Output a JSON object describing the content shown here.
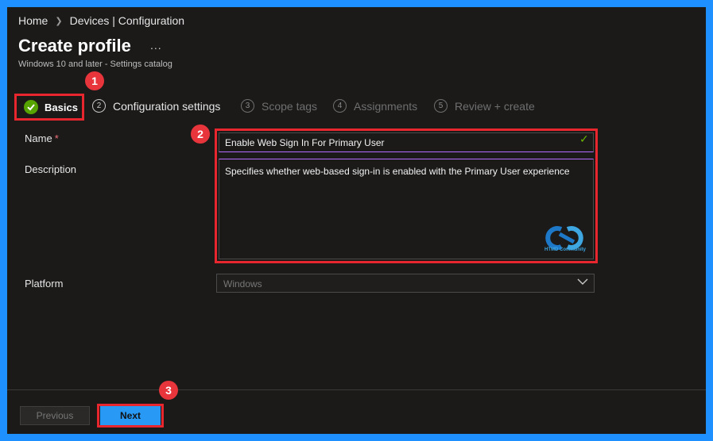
{
  "breadcrumb": {
    "home": "Home",
    "section": "Devices | Configuration"
  },
  "header": {
    "title": "Create profile",
    "more_label": "...",
    "subtitle": "Windows 10 and later - Settings catalog"
  },
  "steps": [
    {
      "num": "",
      "label": "Basics",
      "state": "complete"
    },
    {
      "num": "2",
      "label": "Configuration settings",
      "state": "next"
    },
    {
      "num": "3",
      "label": "Scope tags",
      "state": "disabled"
    },
    {
      "num": "4",
      "label": "Assignments",
      "state": "disabled"
    },
    {
      "num": "5",
      "label": "Review + create",
      "state": "disabled"
    }
  ],
  "annotations": [
    "1",
    "2",
    "3"
  ],
  "form": {
    "name_label": "Name",
    "required_mark": "*",
    "name_value": "Enable Web Sign In For Primary User",
    "description_label": "Description",
    "description_value": "Specifies whether web-based sign-in is enabled with the Primary User experience",
    "platform_label": "Platform",
    "platform_value": "Windows"
  },
  "watermark": {
    "caption": "HTMD Community"
  },
  "footer": {
    "previous_label": "Previous",
    "next_label": "Next"
  },
  "colors": {
    "accent": "#2899f5",
    "success": "#57a300",
    "annotation": "#e8353b",
    "focus": "#b46cff"
  }
}
